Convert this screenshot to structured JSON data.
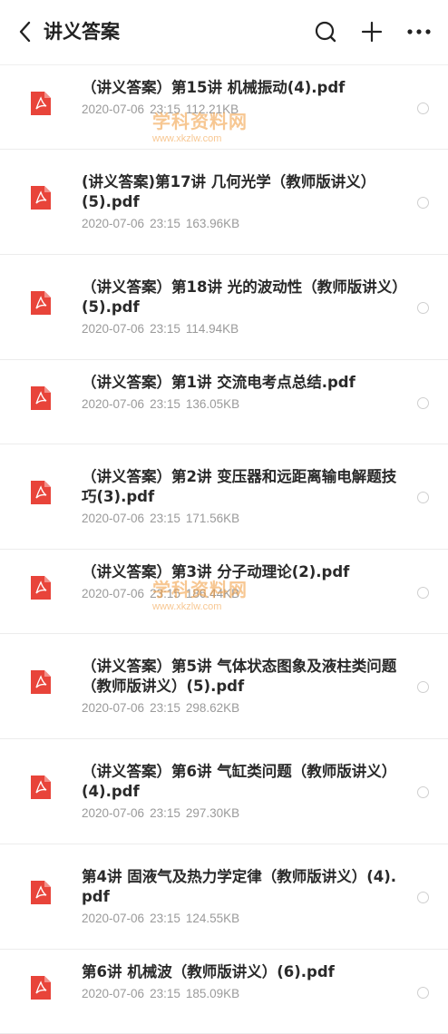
{
  "header": {
    "title": "讲义答案",
    "icons": [
      "back-icon",
      "search-icon",
      "add-icon",
      "more-icon"
    ]
  },
  "files": [
    {
      "name": "（讲义答案）第15讲 机械振动(4).pdf",
      "date": "2020-07-06",
      "time": "23:15",
      "size": "112.21KB"
    },
    {
      "name": "(讲义答案)第17讲 几何光学（教师版讲义）(5).pdf",
      "date": "2020-07-06",
      "time": "23:15",
      "size": "163.96KB"
    },
    {
      "name": "（讲义答案）第18讲 光的波动性（教师版讲义）(5).pdf",
      "date": "2020-07-06",
      "time": "23:15",
      "size": "114.94KB"
    },
    {
      "name": "（讲义答案）第1讲 交流电考点总结.pdf",
      "date": "2020-07-06",
      "time": "23:15",
      "size": "136.05KB"
    },
    {
      "name": "（讲义答案）第2讲 变压器和远距离输电解题技巧(3).pdf",
      "date": "2020-07-06",
      "time": "23:15",
      "size": "171.56KB"
    },
    {
      "name": "（讲义答案）第3讲 分子动理论(2).pdf",
      "date": "2020-07-06",
      "time": "23:15",
      "size": "186.44KB"
    },
    {
      "name": "（讲义答案）第5讲 气体状态图象及液柱类问题（教师版讲义）(5).pdf",
      "date": "2020-07-06",
      "time": "23:15",
      "size": "298.62KB"
    },
    {
      "name": "（讲义答案）第6讲 气缸类问题（教师版讲义）(4).pdf",
      "date": "2020-07-06",
      "time": "23:15",
      "size": "297.30KB"
    },
    {
      "name": "第4讲 固液气及热力学定律（教师版讲义）(4).pdf",
      "date": "2020-07-06",
      "time": "23:15",
      "size": "124.55KB"
    },
    {
      "name": "第6讲 机械波（教师版讲义）(6).pdf",
      "date": "2020-07-06",
      "time": "23:15",
      "size": "185.09KB"
    }
  ],
  "watermark": {
    "text": "学科资料网",
    "url": "www.xkzlw.com"
  },
  "colors": {
    "pdf_red": "#e8443a",
    "meta_gray": "#9a9a9a",
    "watermark_orange": "#f29a3a"
  }
}
